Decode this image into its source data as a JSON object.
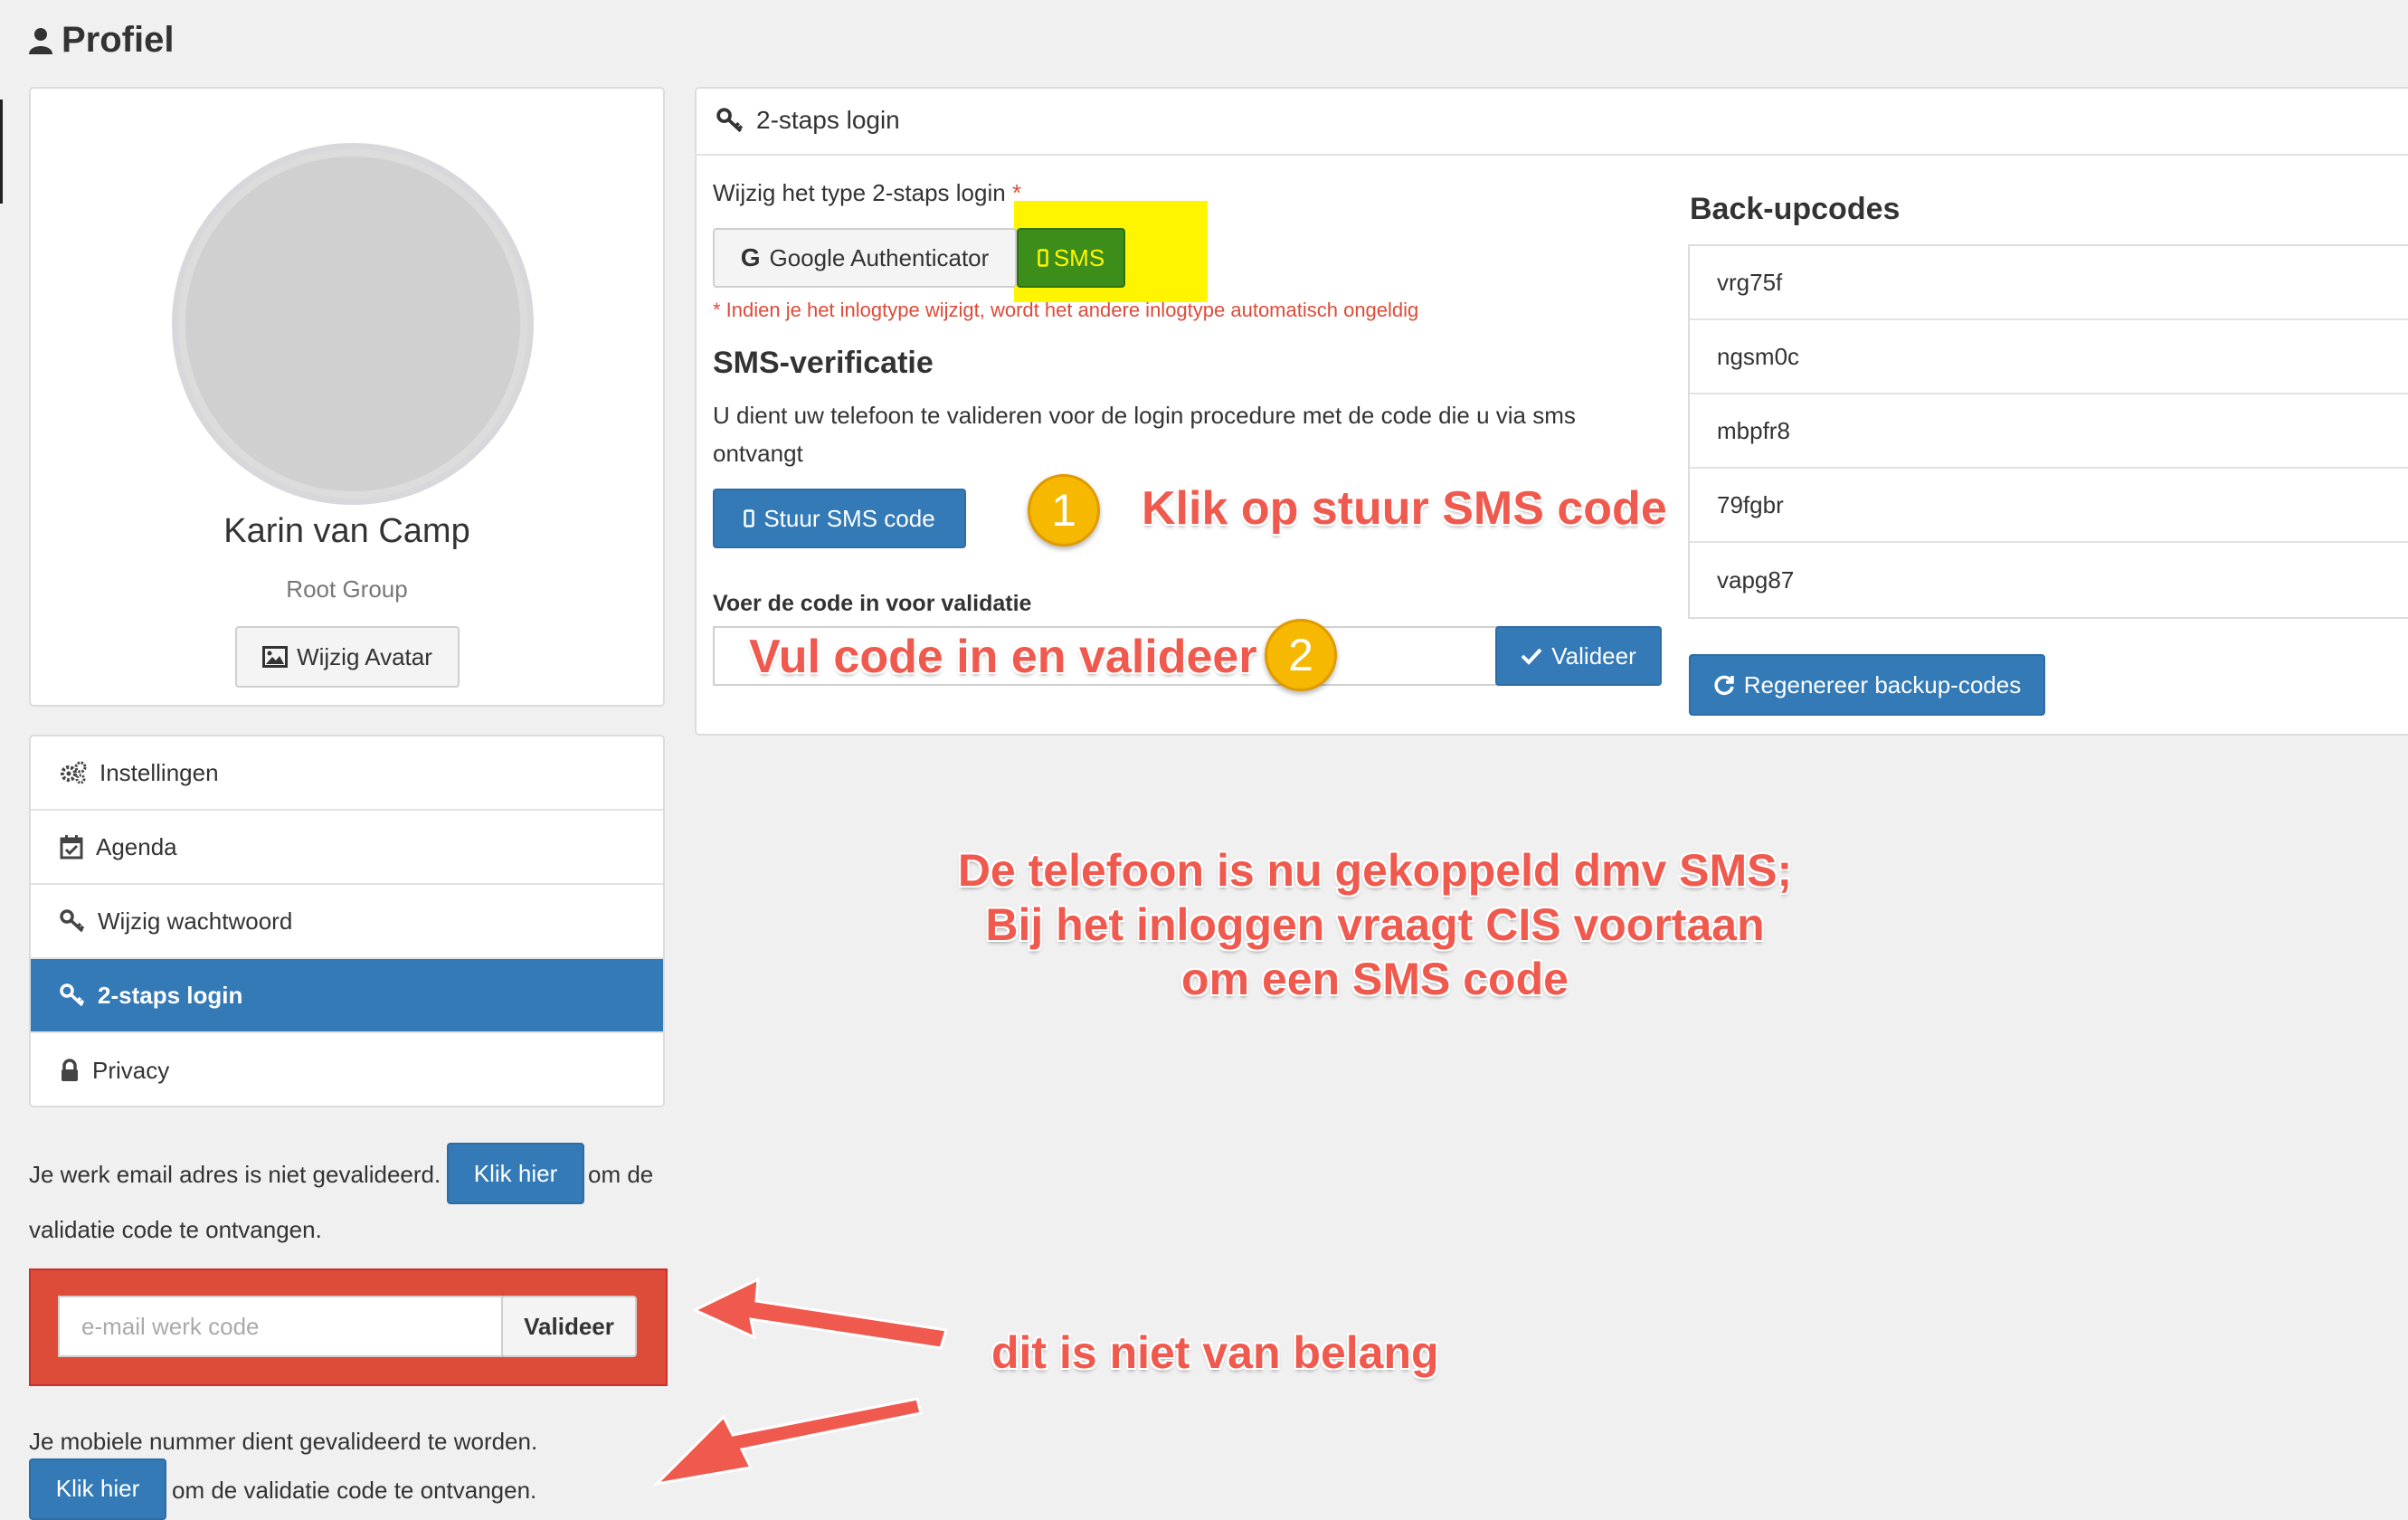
{
  "page": {
    "title": "Profiel"
  },
  "profile": {
    "name": "Karin van Camp",
    "group": "Root Group",
    "change_avatar_label": "Wijzig Avatar"
  },
  "menu": {
    "items": [
      {
        "label": "Instellingen",
        "icon": "cogs-icon",
        "active": false
      },
      {
        "label": "Agenda",
        "icon": "calendar-check-icon",
        "active": false
      },
      {
        "label": "Wijzig wachtwoord",
        "icon": "key-icon",
        "active": false
      },
      {
        "label": "2-staps login",
        "icon": "key-icon",
        "active": true
      },
      {
        "label": "Privacy",
        "icon": "lock-icon",
        "active": false
      }
    ]
  },
  "email_validation": {
    "text_before": "Je werk email adres is niet gevalideerd.",
    "button_label": "Klik hier",
    "text_after_1": "om de",
    "text_after_2": "validatie code te ontvangen.",
    "input_placeholder": "e-mail werk code",
    "validate_label": "Valideer"
  },
  "mobile_validation": {
    "text": "Je mobiele nummer dient gevalideerd te worden.",
    "button_label": "Klik hier",
    "text_after": "om de validatie code te ontvangen."
  },
  "two_step": {
    "header": "2-staps login",
    "type_label": "Wijzig het type 2-staps login",
    "required_mark": "*",
    "options": {
      "google": "Google Authenticator",
      "sms": "SMS"
    },
    "selected": "SMS",
    "warning": "* Indien je het inlogtype wijzigt, wordt het andere inlogtype automatisch ongeldig",
    "sms_title": "SMS-verificatie",
    "sms_help_line1": "U dient uw telefoon te valideren voor de login procedure met de code die u via sms",
    "sms_help_line2": "ontvangt",
    "send_sms_label": "Stuur SMS code",
    "code_label": "Voer de code in voor validatie",
    "validate_label": "Valideer"
  },
  "backup": {
    "title": "Back-upcodes",
    "codes": [
      "vrg75f",
      "ngsm0c",
      "mbpfr8",
      "79fgbr",
      "vapg87"
    ],
    "regenerate_label": "Regenereer backup-codes"
  },
  "annotations": {
    "step1_number": "1",
    "step1_text": "Klik op stuur SMS code",
    "step2_number": "2",
    "step2_text": "Vul code in en valideer",
    "summary_line1": "De telefoon is nu gekoppeld dmv SMS;",
    "summary_line2": "Bij het inloggen vraagt CIS voortaan",
    "summary_line3": "om een SMS code",
    "not_important": "dit is niet van belang"
  },
  "colors": {
    "primary": "#337ab7",
    "danger": "#dd4b39",
    "sms_active": "#3c8d1a",
    "highlight": "#fff500",
    "annotation": "#f05a4e",
    "badge": "#f6b800"
  }
}
